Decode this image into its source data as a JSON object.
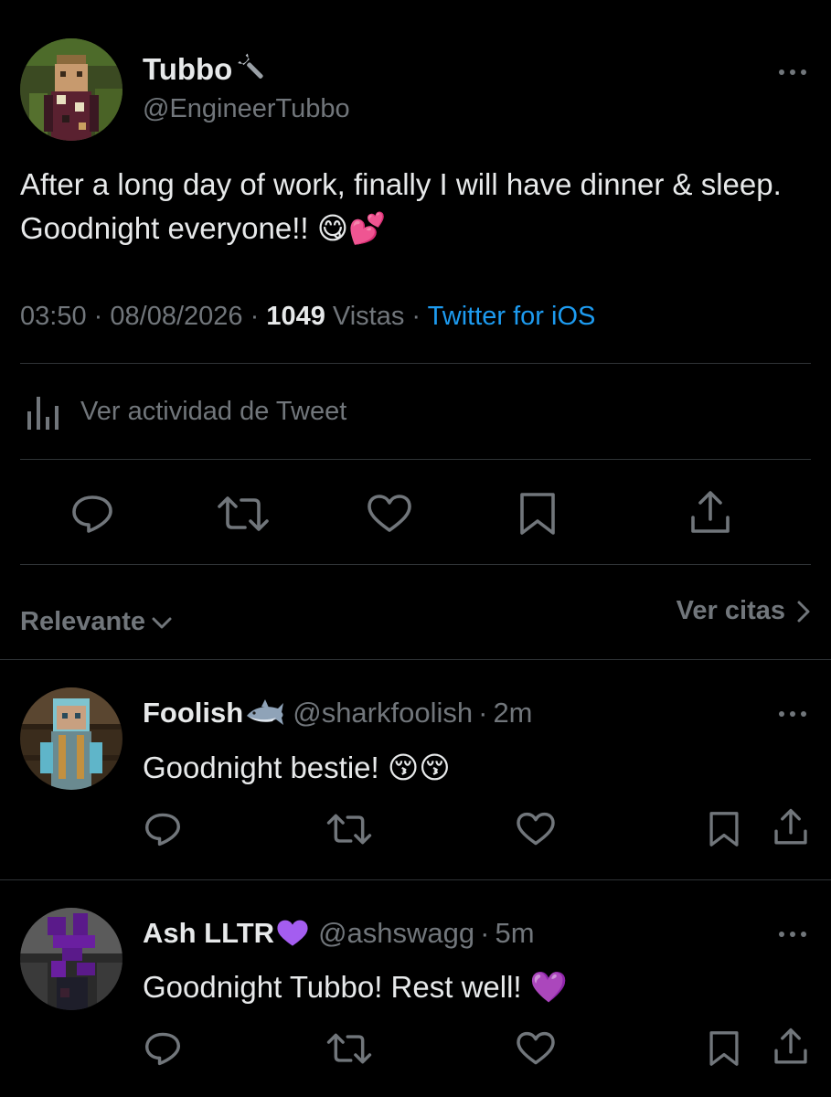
{
  "tweet": {
    "author_name": "Tubbo",
    "author_name_emoji": "🔧",
    "author_handle": "@EngineerTubbo",
    "text": "After a long day of work, finally I will have dinner & sleep. Goodnight everyone!! 😋💕",
    "time": "03:50",
    "separator": "·",
    "date": "08/08/2026",
    "views_count": "1049",
    "views_label": "Vistas",
    "source": "Twitter for iOS",
    "activity_label": "Ver actividad de Tweet"
  },
  "sort": {
    "label": "Relevante",
    "quotes_link": "Ver citas"
  },
  "replies": [
    {
      "name": "Foolish",
      "name_emoji": "🦈",
      "handle": "@sharkfoolish",
      "time": "2m",
      "text": "Goodnight bestie! 😚😚"
    },
    {
      "name": "Ash LLTR",
      "name_emoji": "💜",
      "handle": "@ashswagg",
      "time": "5m",
      "text": "Goodnight Tubbo! Rest well! 💜"
    }
  ],
  "colors": {
    "background": "#000000",
    "text": "#e7e9ea",
    "muted": "#71767b",
    "link": "#1d9bf0",
    "divider": "#2f3336",
    "purple_heart": "#a45df0"
  },
  "icons": [
    "more-icon",
    "wrench-icon",
    "analytics-icon",
    "reply-icon",
    "retweet-icon",
    "like-icon",
    "bookmark-icon",
    "share-icon",
    "chevron-down-icon",
    "chevron-right-icon",
    "shark-icon",
    "purple-heart-icon",
    "kissing-face-icon",
    "yum-face-icon",
    "two-hearts-icon"
  ]
}
